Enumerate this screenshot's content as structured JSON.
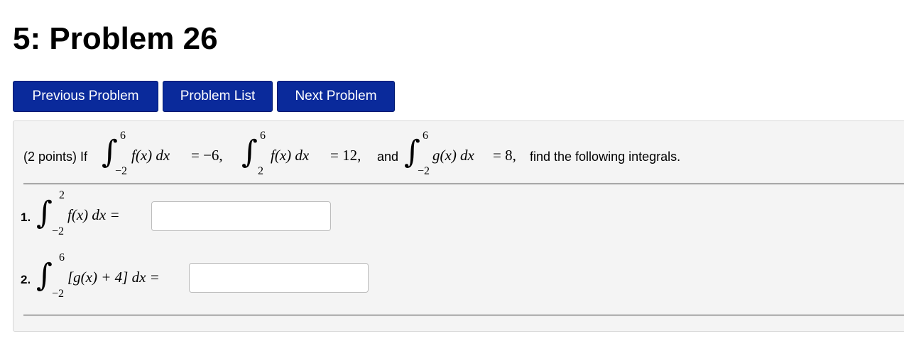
{
  "page": {
    "title": "5: Problem 26"
  },
  "nav": {
    "previous_label": "Previous Problem",
    "list_label": "Problem List",
    "next_label": "Next Problem"
  },
  "problem": {
    "prefix": "(2 points) If",
    "given1": {
      "lower": "−2",
      "upper": "6",
      "integrand": "f(x) dx",
      "rhs": "= −6,"
    },
    "given2": {
      "lower": "2",
      "upper": "6",
      "integrand": "f(x) dx",
      "rhs": "= 12,"
    },
    "conj": "and",
    "given3": {
      "lower": "−2",
      "upper": "6",
      "integrand": "g(x) dx",
      "rhs": "= 8,"
    },
    "suffix": "find the following integrals.",
    "parts": [
      {
        "number": "1.",
        "lower": "−2",
        "upper": "2",
        "expression": "f(x) dx =",
        "answer": ""
      },
      {
        "number": "2.",
        "lower": "−2",
        "upper": "6",
        "expression": "[g(x) + 4] dx =",
        "answer": ""
      }
    ]
  }
}
